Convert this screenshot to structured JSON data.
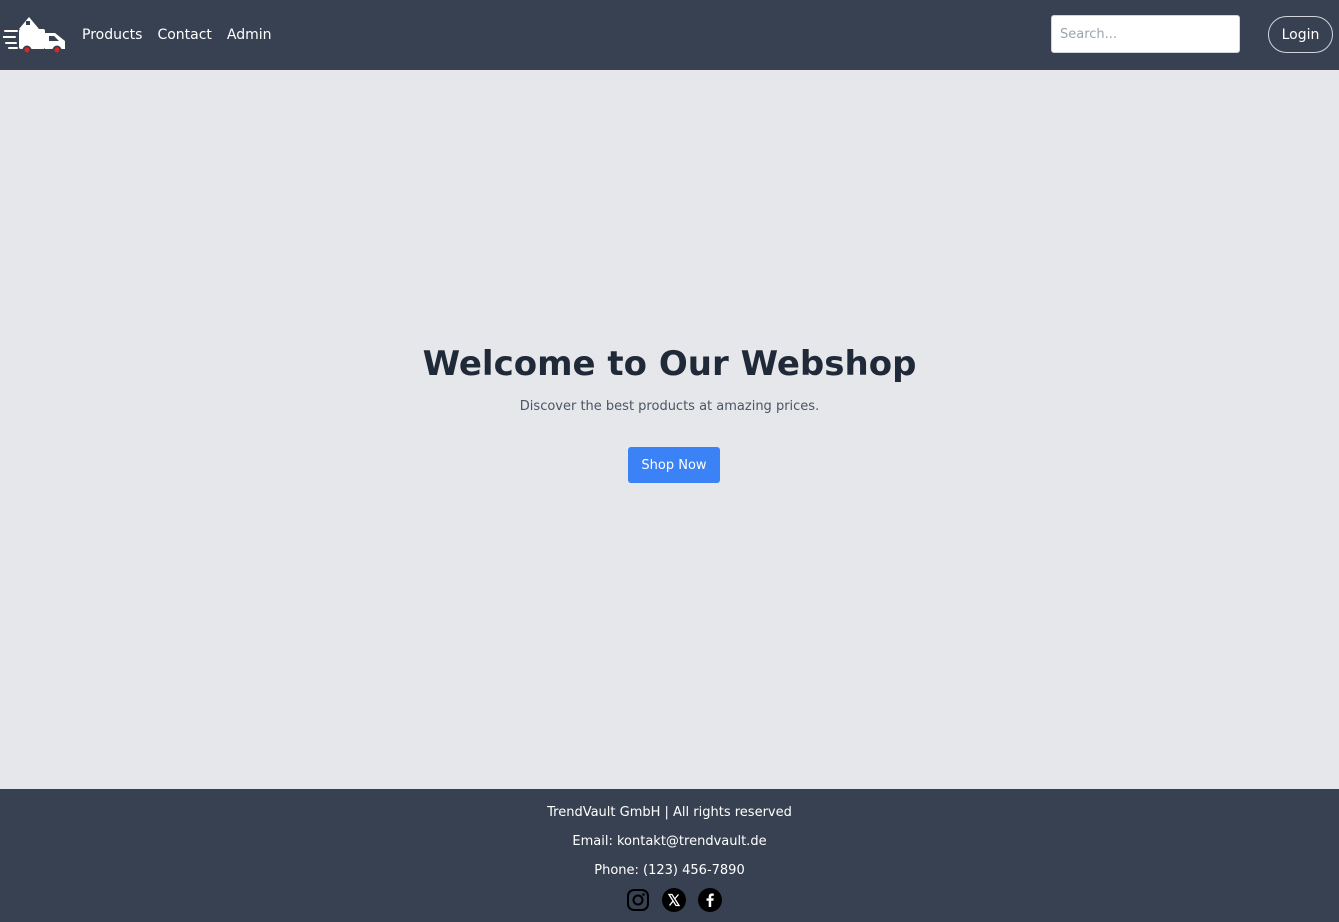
{
  "nav": {
    "links": [
      "Products",
      "Contact",
      "Admin"
    ],
    "search_placeholder": "Search...",
    "login_label": "Login"
  },
  "hero": {
    "title": "Welcome to Our Webshop",
    "subtitle": "Discover the best products at amazing prices.",
    "button_label": "Shop Now"
  },
  "footer": {
    "company": "TrendVault GmbH | All rights reserved",
    "email": "Email: kontakt@trendvault.de",
    "phone": "Phone: (123) 456-7890",
    "social_icons": [
      "instagram-icon",
      "x-icon",
      "facebook-icon"
    ]
  },
  "colors": {
    "navbar_bg": "#374151",
    "page_bg": "#e5e7eb",
    "accent": "#3b82f6"
  }
}
